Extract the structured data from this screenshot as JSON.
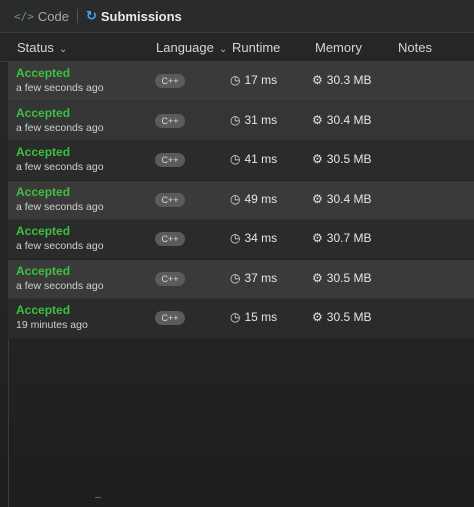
{
  "tabs": {
    "code_label": "Code",
    "submissions_label": "Submissions"
  },
  "header": {
    "status": "Status",
    "language": "Language",
    "runtime": "Runtime",
    "memory": "Memory",
    "notes": "Notes"
  },
  "rows": [
    {
      "status": "Accepted",
      "time": "a few seconds ago",
      "lang": "C++",
      "runtime": "17 ms",
      "memory": "30.3 MB"
    },
    {
      "status": "Accepted",
      "time": "a few seconds ago",
      "lang": "C++",
      "runtime": "31 ms",
      "memory": "30.4 MB"
    },
    {
      "status": "Accepted",
      "time": "a few seconds ago",
      "lang": "C++",
      "runtime": "41 ms",
      "memory": "30.5 MB"
    },
    {
      "status": "Accepted",
      "time": "a few seconds ago",
      "lang": "C++",
      "runtime": "49 ms",
      "memory": "30.4 MB"
    },
    {
      "status": "Accepted",
      "time": "a few seconds ago",
      "lang": "C++",
      "runtime": "34 ms",
      "memory": "30.7 MB"
    },
    {
      "status": "Accepted",
      "time": "a few seconds ago",
      "lang": "C++",
      "runtime": "37 ms",
      "memory": "30.5 MB"
    },
    {
      "status": "Accepted",
      "time": "19 minutes ago",
      "lang": "C++",
      "runtime": "15 ms",
      "memory": "30.5 MB"
    }
  ],
  "icons": {
    "code": "code-icon",
    "submissions": "history-icon",
    "runtime": "clock-icon",
    "memory": "chip-icon"
  },
  "colors": {
    "accepted": "#3fbf3f",
    "accent": "#3ea6ff"
  }
}
